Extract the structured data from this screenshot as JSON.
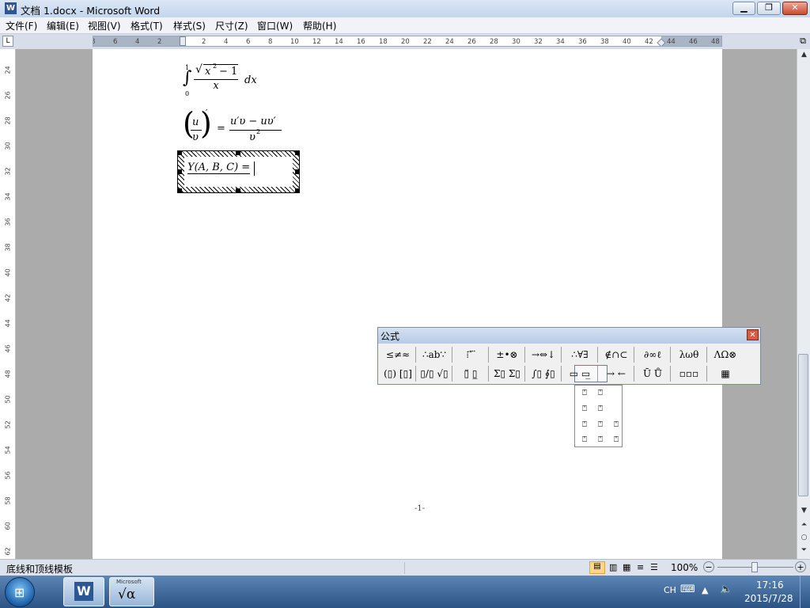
{
  "window": {
    "title": "文档 1.docx - Microsoft Word",
    "minimize_icon": "minimize-icon",
    "restore_icon": "restore-icon",
    "close_label": "✕"
  },
  "menu": [
    {
      "label": "文件(F)"
    },
    {
      "label": "编辑(E)"
    },
    {
      "label": "视图(V)"
    },
    {
      "label": "格式(T)"
    },
    {
      "label": "样式(S)"
    },
    {
      "label": "尺寸(Z)"
    },
    {
      "label": "窗口(W)"
    },
    {
      "label": "帮助(H)"
    }
  ],
  "ruler": {
    "horizontal_ticks": [
      "8",
      "6",
      "4",
      "2",
      "2",
      "4",
      "6",
      "8",
      "10",
      "12",
      "14",
      "16",
      "18",
      "20",
      "22",
      "24",
      "26",
      "28",
      "30",
      "32",
      "34",
      "36",
      "38",
      "40",
      "42",
      "44",
      "46",
      "48"
    ],
    "vertical_ticks": [
      "24",
      "26",
      "28",
      "30",
      "32",
      "34",
      "36",
      "38",
      "40",
      "42",
      "44",
      "46",
      "48",
      "50",
      "52",
      "54",
      "56",
      "58",
      "60",
      "62"
    ]
  },
  "document": {
    "eq1": {
      "upper": "1",
      "lower": "0",
      "radicand": "x",
      "exp": "2",
      "minus": "− 1",
      "denominator": "x",
      "dx": "dx"
    },
    "eq2": {
      "u": "u",
      "v": "υ",
      "prime": "′",
      "equals": "=",
      "rhs_num": "u′υ − uυ′",
      "rhs_den": "υ",
      "rhs_den_exp": "2"
    },
    "eq3": {
      "text": "Y(A, B, C) ="
    },
    "page_number": "-1-"
  },
  "equation_toolbar": {
    "title": "公式",
    "close": "✕",
    "row1": [
      "≤≠≈",
      "∴ab∵",
      "⁞ ⃗ ⃛",
      "±•⊗",
      "→⇔↓",
      "∴∀∃",
      "∉∩⊂",
      "∂∞ℓ",
      "λωθ",
      "ΛΩ⊗"
    ],
    "row2": [
      "(▯) [▯]",
      "▯/▯ √▯",
      "▯̈ ▯̲",
      "Σ▯ Σ▯",
      "∫▯ ∮▯",
      "▭ ▭̲",
      "→ ←",
      "Ū Ů",
      "▫▫▫",
      "▦"
    ]
  },
  "template_menu": {
    "items": [
      "⍞",
      "⍞",
      "⍞",
      "⍞",
      "⍞",
      "⍞",
      "⍞",
      "⍞",
      "⍞",
      "⍞"
    ]
  },
  "status": {
    "text": "底线和顶线模板",
    "zoom": "100%",
    "zoom_minus": "−",
    "zoom_plus": "+"
  },
  "taskbar": {
    "app_word_label": "W",
    "app_eq_top": "Microsoft",
    "app_eq_label": "√α",
    "ime": "CH",
    "time": "17:16",
    "date": "2015/7/28"
  }
}
